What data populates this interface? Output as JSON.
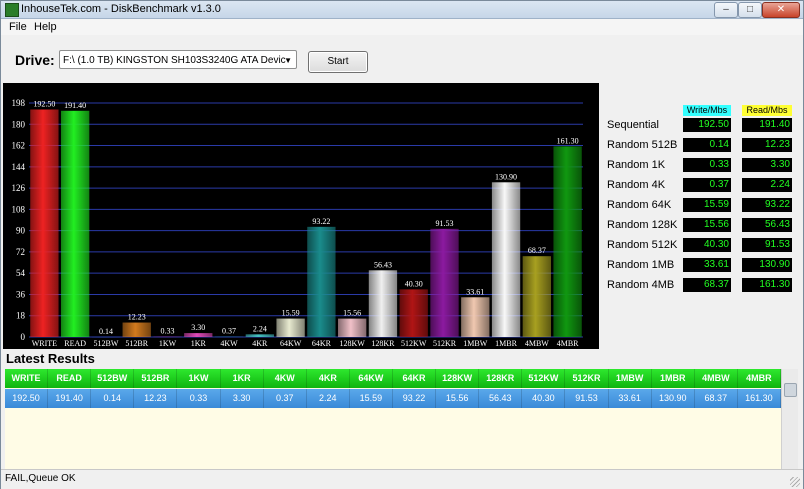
{
  "window": {
    "title": "InhouseTek.com - DiskBenchmark v1.3.0",
    "controls": {
      "minimize": "–",
      "maximize": "□",
      "close": "✕"
    }
  },
  "menu": {
    "items": [
      "File",
      "Help"
    ]
  },
  "toolbar": {
    "drive_label": "Drive:",
    "drive_value": "F:\\ (1.0 TB) KINGSTON SH103S3240G ATA Devic",
    "start_label": "Start"
  },
  "chart_data": {
    "type": "bar",
    "ylim": [
      0,
      198
    ],
    "yticks": [
      0,
      18,
      36,
      54,
      72,
      90,
      108,
      126,
      144,
      162,
      180,
      198
    ],
    "categories": [
      "WRITE",
      "READ",
      "512BW",
      "512BR",
      "1KW",
      "1KR",
      "4KW",
      "4KR",
      "64KW",
      "64KR",
      "128KW",
      "128KR",
      "512KW",
      "512KR",
      "1MBW",
      "1MBR",
      "4MBW",
      "4MBR"
    ],
    "values": [
      192.5,
      191.4,
      0.14,
      12.23,
      0.33,
      3.3,
      0.37,
      2.24,
      15.59,
      93.22,
      15.56,
      56.43,
      40.3,
      91.53,
      33.61,
      130.9,
      68.37,
      161.3
    ],
    "labels": [
      "192.50",
      "191.40",
      "0.14",
      "12.23",
      "0.33",
      "3.30",
      "0.37",
      "2.24",
      "15.59",
      "93.22",
      "15.56",
      "56.43",
      "40.30",
      "91.53",
      "33.61",
      "130.90",
      "68.37",
      "161.30"
    ],
    "colors": [
      "#ee2222",
      "#22ee22",
      "#3b5bd6",
      "#d27a1e",
      "#9a40c8",
      "#e04ab8",
      "#2a7ac8",
      "#46c4c4",
      "#e8ead0",
      "#1a8c8c",
      "#f0c0c8",
      "#f0f0f0",
      "#b01515",
      "#8c1aa0",
      "#f0c8b0",
      "#f8f8f8",
      "#a8a020",
      "#109810"
    ],
    "grid": true
  },
  "stats": {
    "write_header": "Write/Mbs",
    "read_header": "Read/Mbs",
    "rows": [
      {
        "label": "Sequential",
        "write": "192.50",
        "read": "191.40"
      },
      {
        "label": "Random 512B",
        "write": "0.14",
        "read": "12.23"
      },
      {
        "label": "Random 1K",
        "write": "0.33",
        "read": "3.30"
      },
      {
        "label": "Random 4K",
        "write": "0.37",
        "read": "2.24"
      },
      {
        "label": "Random 64K",
        "write": "15.59",
        "read": "93.22"
      },
      {
        "label": "Random 128K",
        "write": "15.56",
        "read": "56.43"
      },
      {
        "label": "Random 512K",
        "write": "40.30",
        "read": "91.53"
      },
      {
        "label": "Random 1MB",
        "write": "33.61",
        "read": "130.90"
      },
      {
        "label": "Random 4MB",
        "write": "68.37",
        "read": "161.30"
      }
    ]
  },
  "results": {
    "title": "Latest Results",
    "columns": [
      "WRITE",
      "READ",
      "512BW",
      "512BR",
      "1KW",
      "1KR",
      "4KW",
      "4KR",
      "64KW",
      "64KR",
      "128KW",
      "128KR",
      "512KW",
      "512KR",
      "1MBW",
      "1MBR",
      "4MBW",
      "4MBR"
    ],
    "row": [
      "192.50",
      "191.40",
      "0.14",
      "12.23",
      "0.33",
      "3.30",
      "0.37",
      "2.24",
      "15.59",
      "93.22",
      "15.56",
      "56.43",
      "40.30",
      "91.53",
      "33.61",
      "130.90",
      "68.37",
      "161.30"
    ]
  },
  "status": {
    "text": "FAIL,Queue OK"
  }
}
